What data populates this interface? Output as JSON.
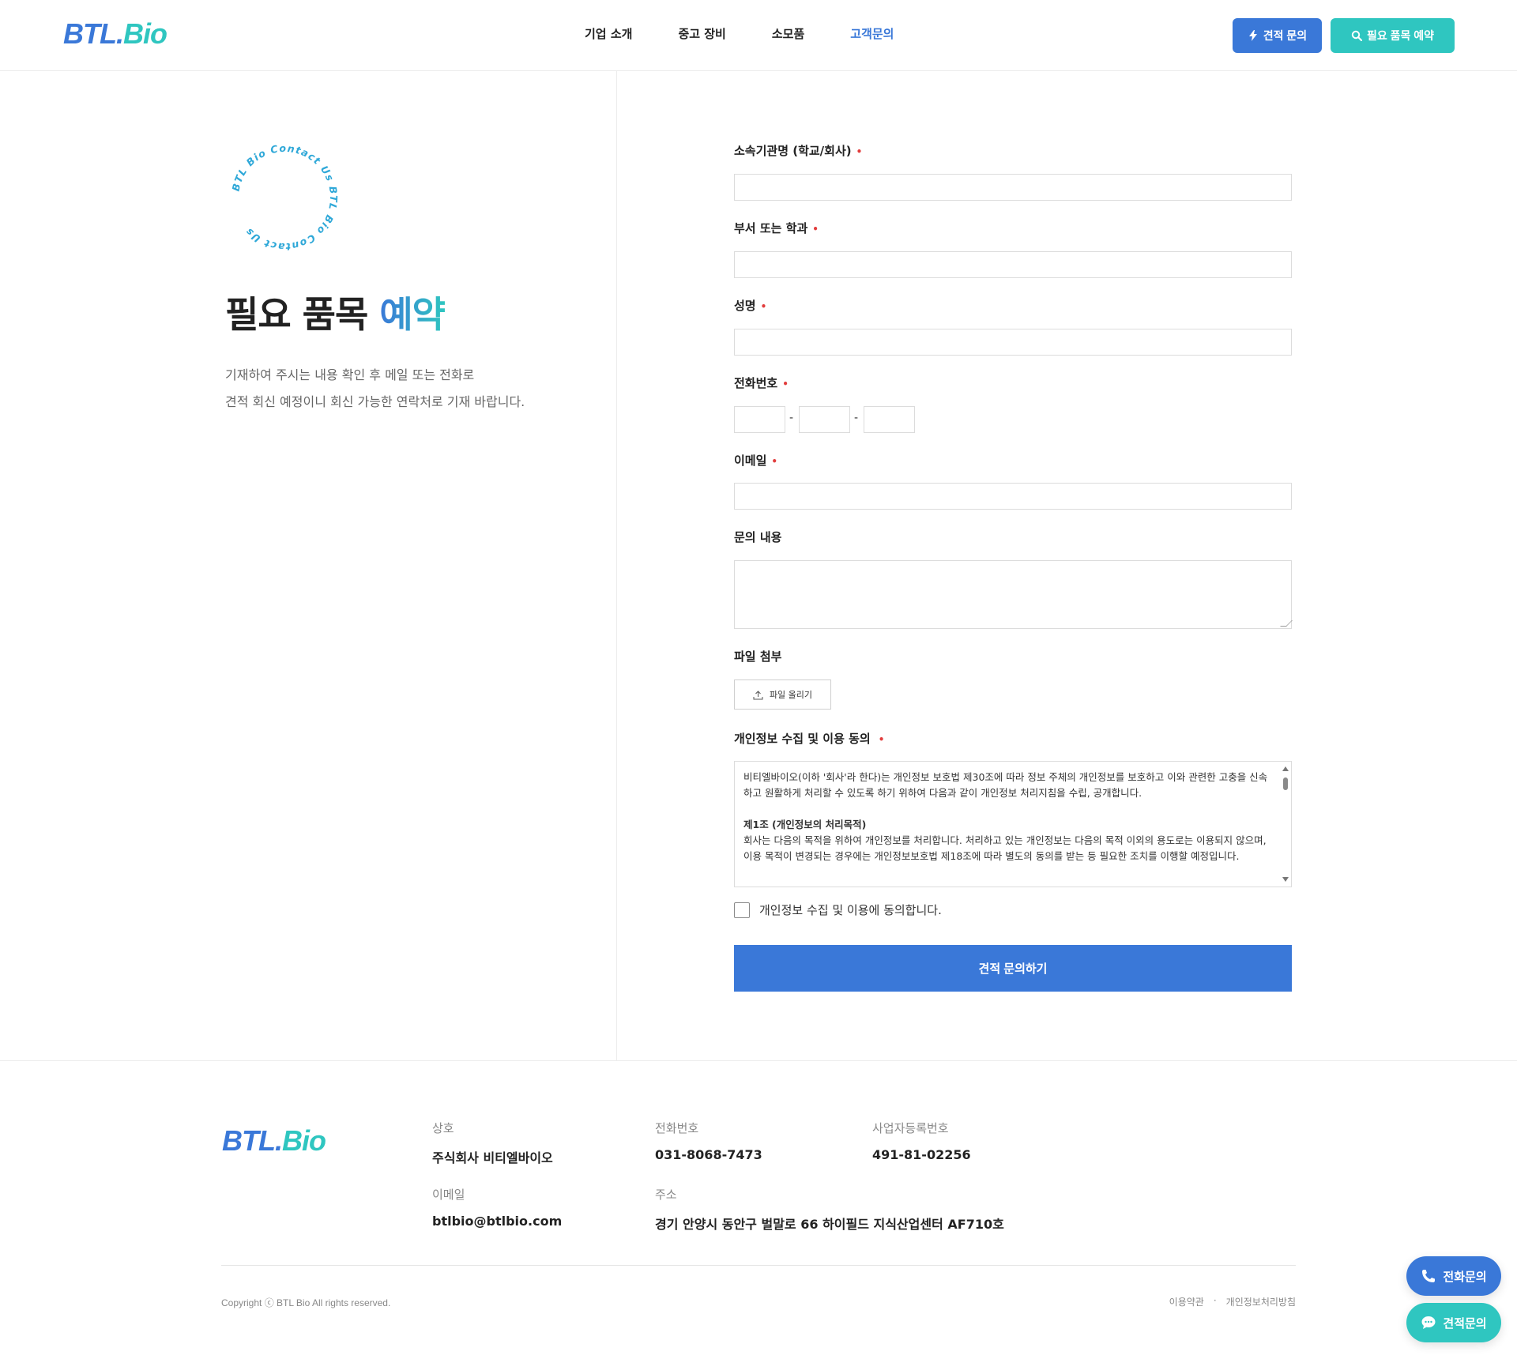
{
  "header": {
    "logo_part1": "BTL.",
    "logo_part2": "Bio",
    "nav": [
      {
        "label": "기업 소개"
      },
      {
        "label": "중고 장비"
      },
      {
        "label": "소모품"
      },
      {
        "label": "고객문의",
        "active": true
      }
    ],
    "quote_button": "견적 문의",
    "reserve_button": "필요 품목 예약"
  },
  "intro": {
    "badge_text": "BTL Bio Contact Us BTL Bio Contact Us",
    "title_main": "필요 품목 ",
    "title_accent": "예약",
    "desc_line1": "기재하여 주시는 내용 확인 후 메일 또는 전화로",
    "desc_line2": "견적 회신 예정이니 회신 가능한 연락처로 기재 바랍니다."
  },
  "form": {
    "org_label": "소속기관명 (학교/회사)",
    "dept_label": "부서 또는 학과",
    "name_label": "성명",
    "phone_label": "전화번호",
    "phone_sep": "-",
    "email_label": "이메일",
    "inquiry_label": "문의 내용",
    "file_label": "파일 첨부",
    "file_button": "파일 올리기",
    "privacy_label": "개인정보 수집 및 이용 동의",
    "required_mark": "•",
    "privacy_p1": "비티엘바이오(이하 '회사'라 한다)는 개인정보 보호법 제30조에 따라 정보 주체의 개인정보를 보호하고 이와 관련한 고충을 신속하고 원활하게 처리할 수 있도록 하기 위하여 다음과 같이 개인정보 처리지침을 수립, 공개합니다.",
    "privacy_s1_title": "제1조 (개인정보의 처리목적)",
    "privacy_s1_body": "회사는 다음의 목적을 위하여 개인정보를 처리합니다. 처리하고 있는 개인정보는 다음의 목적 이외의 용도로는 이용되지 않으며, 이용 목적이 변경되는 경우에는 개인정보보호법 제18조에 따라 별도의 동의를 받는 등 필요한 조치를 이행할 예정입니다.",
    "agree_label": "개인정보 수집 및 이용에 동의합니다.",
    "submit_label": "견적 문의하기"
  },
  "footer": {
    "logo_part1": "BTL.",
    "logo_part2": "Bio",
    "company_key": "상호",
    "company_val": "주식회사 비티엘바이오",
    "phone_key": "전화번호",
    "phone_val": "031-8068-7473",
    "biz_key": "사업자등록번호",
    "biz_val": "491-81-02256",
    "email_key": "이메일",
    "email_val": "btlbio@btlbio.com",
    "addr_key": "주소",
    "addr_val": "경기 안양시 동안구 벌말로 66 하이필드 지식산업센터 AF710호",
    "copyright": "Copyright ⓒ BTL Bio All rights reserved.",
    "terms_link": "이용약관",
    "link_sep": "·",
    "privacy_link": "개인정보처리방침"
  },
  "floating": {
    "phone_button": "전화문의",
    "chat_button": "견적문의"
  },
  "colors": {
    "brand_blue": "#3a78d8",
    "brand_teal": "#2fc6c0",
    "required_red": "#e23d3d"
  }
}
